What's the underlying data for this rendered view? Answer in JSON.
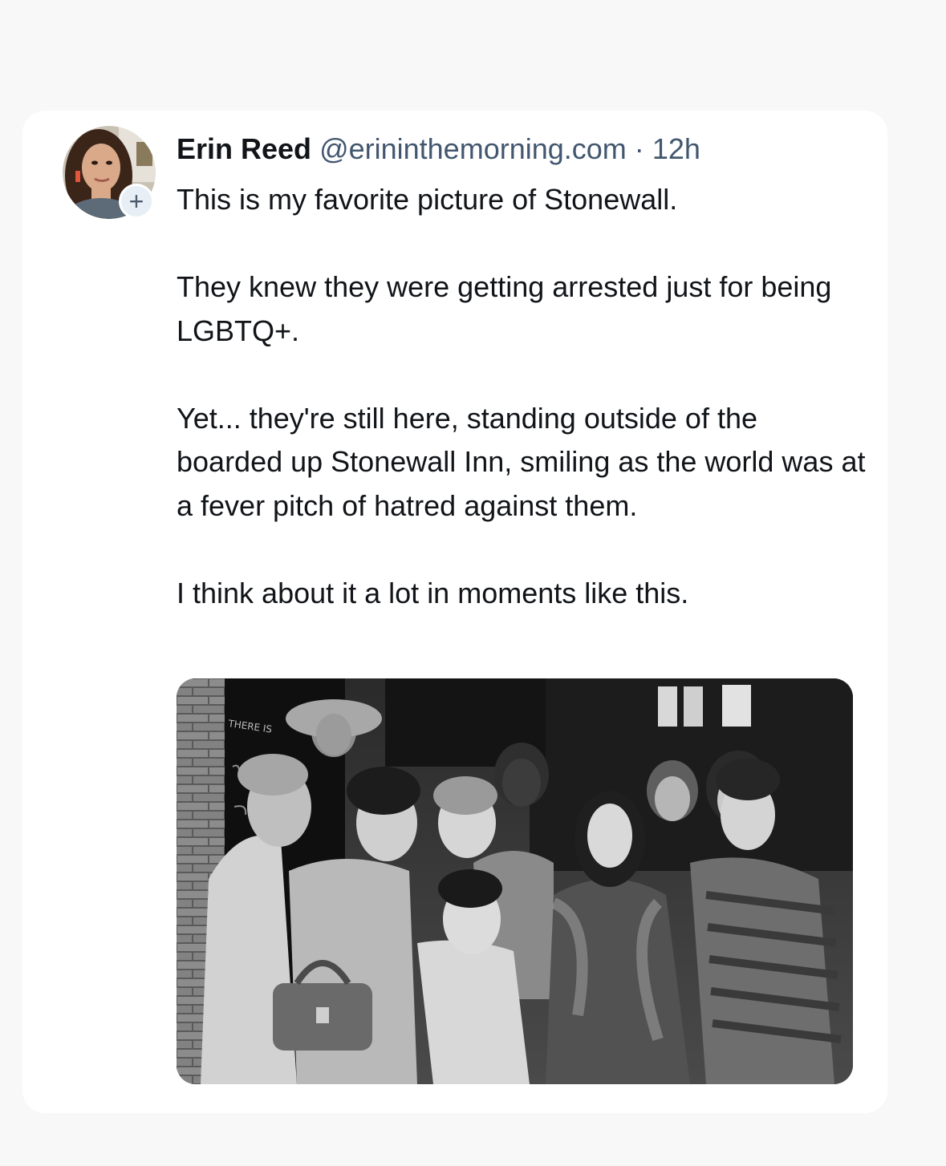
{
  "post": {
    "author_name": "Erin Reed",
    "author_handle": "@erininthemorning.com",
    "separator": "·",
    "timestamp": "12h",
    "follow_symbol": "+",
    "paragraphs": [
      "This is my favorite picture of Stonewall.",
      "They knew they were getting arrested just for being LGBTQ+.",
      "Yet... they're still here, standing outside of the boarded up Stonewall Inn, smiling as the world was at a fever pitch of hatred against them.",
      "I think about it a lot in moments like this."
    ],
    "image_sign_text": "THERE IS"
  }
}
